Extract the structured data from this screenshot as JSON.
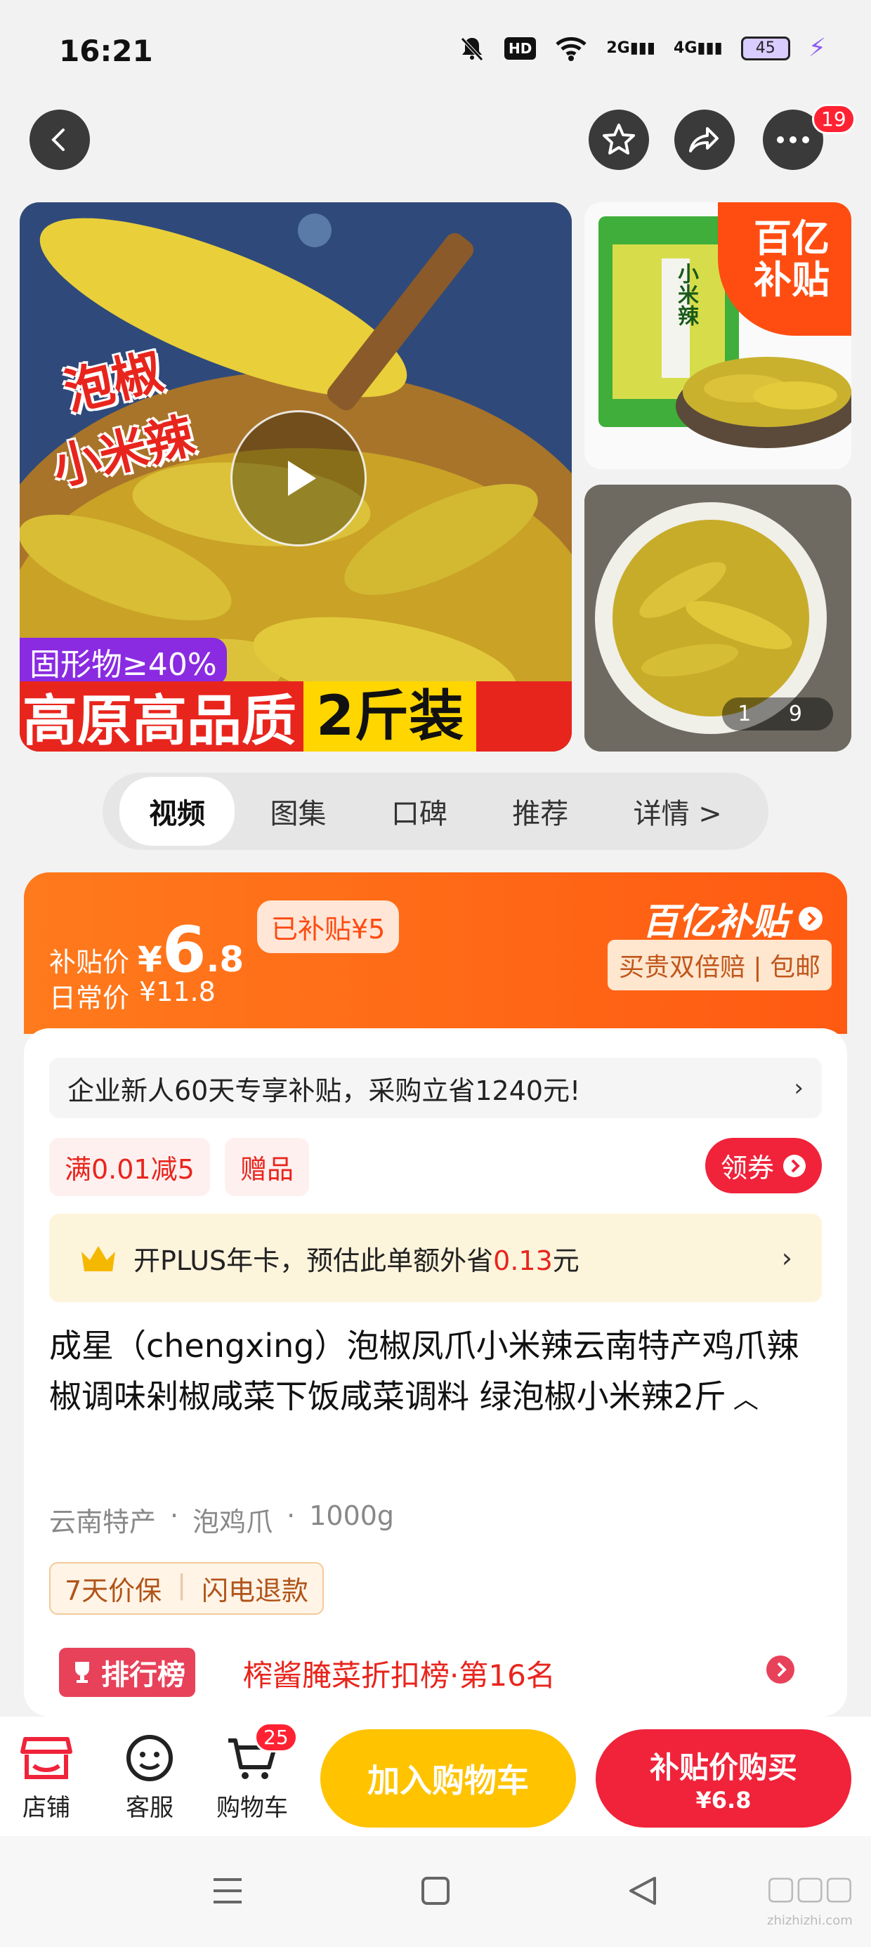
{
  "status_bar": {
    "time": "16:21",
    "hd": "HD",
    "net1": "2G",
    "net2": "4G",
    "battery": "45"
  },
  "nav": {
    "more_badge": "19"
  },
  "media": {
    "overlay_line1": "泡椒",
    "overlay_line2": "小米辣",
    "solid_tag": "固形物≥40%",
    "banner_text": "高原高品质",
    "banner_pack": "2斤装",
    "subsidy_corner": "百亿补贴",
    "package_label": "小米辣",
    "counter": "1 9"
  },
  "tabs": [
    {
      "label": "视频",
      "active": true
    },
    {
      "label": "图集",
      "active": false
    },
    {
      "label": "口碑",
      "active": false
    },
    {
      "label": "推荐",
      "active": false
    },
    {
      "label": "详情 >",
      "active": false
    }
  ],
  "price": {
    "subsidy_label": "补贴价",
    "currency": "¥",
    "price_int": "6",
    "price_dec": ".8",
    "subsidized_tag": "已补贴¥5",
    "daily_label": "日常价",
    "daily_price": "¥11.8",
    "brand_text": "百亿补贴",
    "guarantee": "买贵双倍赔 | 包邮"
  },
  "promo": {
    "enterprise_text": "企业新人60天专享补贴，采购立省1240元!",
    "coupon1": "满0.01减5",
    "coupon2": "赠品",
    "get_coupon": "领券",
    "plus_pre": "开PLUS年卡，预估此单额外省",
    "plus_amount": "0.13",
    "plus_post": "元"
  },
  "product": {
    "title": "成星（chengxing）泡椒凤爪小米辣云南特产鸡爪辣椒调味剁椒咸菜下饭咸菜调料 绿泡椒小米辣2斤",
    "tags": [
      "云南特产",
      "泡鸡爪",
      "1000g"
    ],
    "services": [
      "7天价保",
      "闪电退款"
    ],
    "rank_badge": "排行榜",
    "rank_text": "榨酱腌菜折扣榜·第16名"
  },
  "bottom": {
    "store": "店铺",
    "service": "客服",
    "cart": "购物车",
    "cart_badge": "25",
    "add_cart": "加入购物车",
    "buy_label": "补贴价购买",
    "buy_price": "¥6.8"
  },
  "watermark": "zhizhizhi.com",
  "colors": {
    "accent": "#ff5a12",
    "red": "#f0233a",
    "yellow": "#ffc300"
  }
}
